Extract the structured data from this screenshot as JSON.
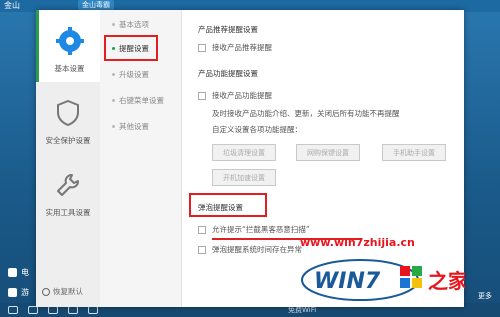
{
  "background": {
    "app_title": "金山",
    "top_tab": "金山毒霸",
    "left_items": [
      "电",
      "游"
    ],
    "bottom_items": [
      "免费WiFi"
    ],
    "right_label": "更多"
  },
  "dialog": {
    "sidebar": {
      "items": [
        {
          "label": "基本设置",
          "icon": "gear-icon",
          "active": true
        },
        {
          "label": "安全保护设置",
          "icon": "shield-icon",
          "active": false
        },
        {
          "label": "实用工具设置",
          "icon": "wrench-icon",
          "active": false
        }
      ],
      "restore_label": "恢复默认"
    },
    "subnav": {
      "items": [
        {
          "label": "基本选项",
          "active": false
        },
        {
          "label": "提醒设置",
          "active": true
        },
        {
          "label": "升级设置",
          "active": false
        },
        {
          "label": "右键菜单设置",
          "active": false
        },
        {
          "label": "其他设置",
          "active": false
        }
      ]
    },
    "content": {
      "product_recommend": {
        "title": "产品推荐提醒设置",
        "checkbox_label": "接收产品推荐提醒"
      },
      "product_feature": {
        "title": "产品功能提醒设置",
        "checkbox_label": "接收产品功能提醒",
        "desc_line1": "及时接收产品功能介绍、更新，关闭后所有功能不再提醒",
        "desc_line2": "自定义设置各项功能提醒：",
        "buttons": [
          "垃圾清理设置",
          "网购保镖设置",
          "手机助手设置",
          "开机加速设置"
        ]
      },
      "popup": {
        "title": "弹泡提醒设置",
        "checkbox1_label": "允许提示“拦截黑客恶意扫描”",
        "checkbox2_label": "弹泡提醒系统时间存在异常"
      }
    }
  },
  "watermark": {
    "url": "www.win7zhijia.cn",
    "logo_text": "WIN7",
    "logo_suffix": "之家"
  },
  "colors": {
    "accent_green": "#2a9d48",
    "highlight_red": "#e02020",
    "watermark_red": "#e8161c",
    "sidebar_bg": "#eeeeee"
  }
}
